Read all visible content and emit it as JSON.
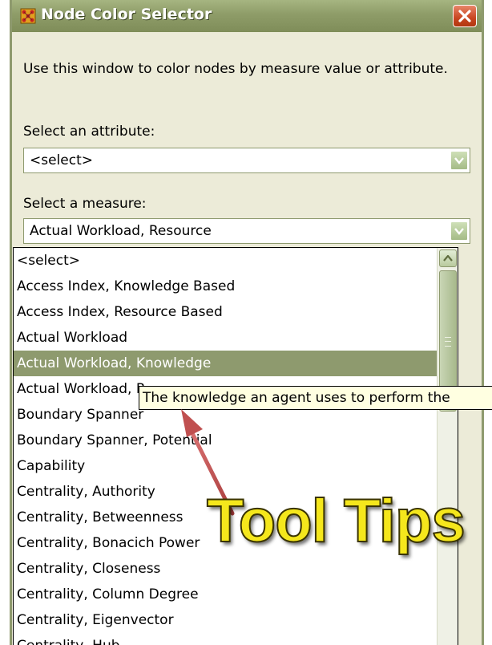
{
  "window": {
    "title": "Node Color Selector"
  },
  "description": "Use this window to color nodes by measure value or attribute.",
  "attribute": {
    "label": "Select an attribute:",
    "value": "<select>"
  },
  "measure": {
    "label": "Select a measure:",
    "value": "Actual Workload, Resource"
  },
  "measure_list": {
    "items": [
      "<select>",
      "Access Index, Knowledge Based",
      "Access Index, Resource Based",
      "Actual Workload",
      "Actual Workload, Knowledge",
      "Actual Workload, R",
      "Boundary Spanner",
      "Boundary Spanner, Potential",
      "Capability",
      "Centrality, Authority",
      "Centrality, Betweenness",
      "Centrality, Bonacich Power",
      "Centrality, Closeness",
      "Centrality, Column Degree",
      "Centrality, Eigenvector",
      "Centrality, Hub"
    ],
    "selected_index": 4
  },
  "tooltip": {
    "text": "The knowledge an agent uses to perform the"
  },
  "annotation": {
    "text": "Tool Tips"
  },
  "colors": {
    "accent": "#8E9A6E",
    "tooltip_bg": "#FFFFE1",
    "annotation": "#F5E71C",
    "arrow": "#C05050",
    "close": "#C94520"
  }
}
